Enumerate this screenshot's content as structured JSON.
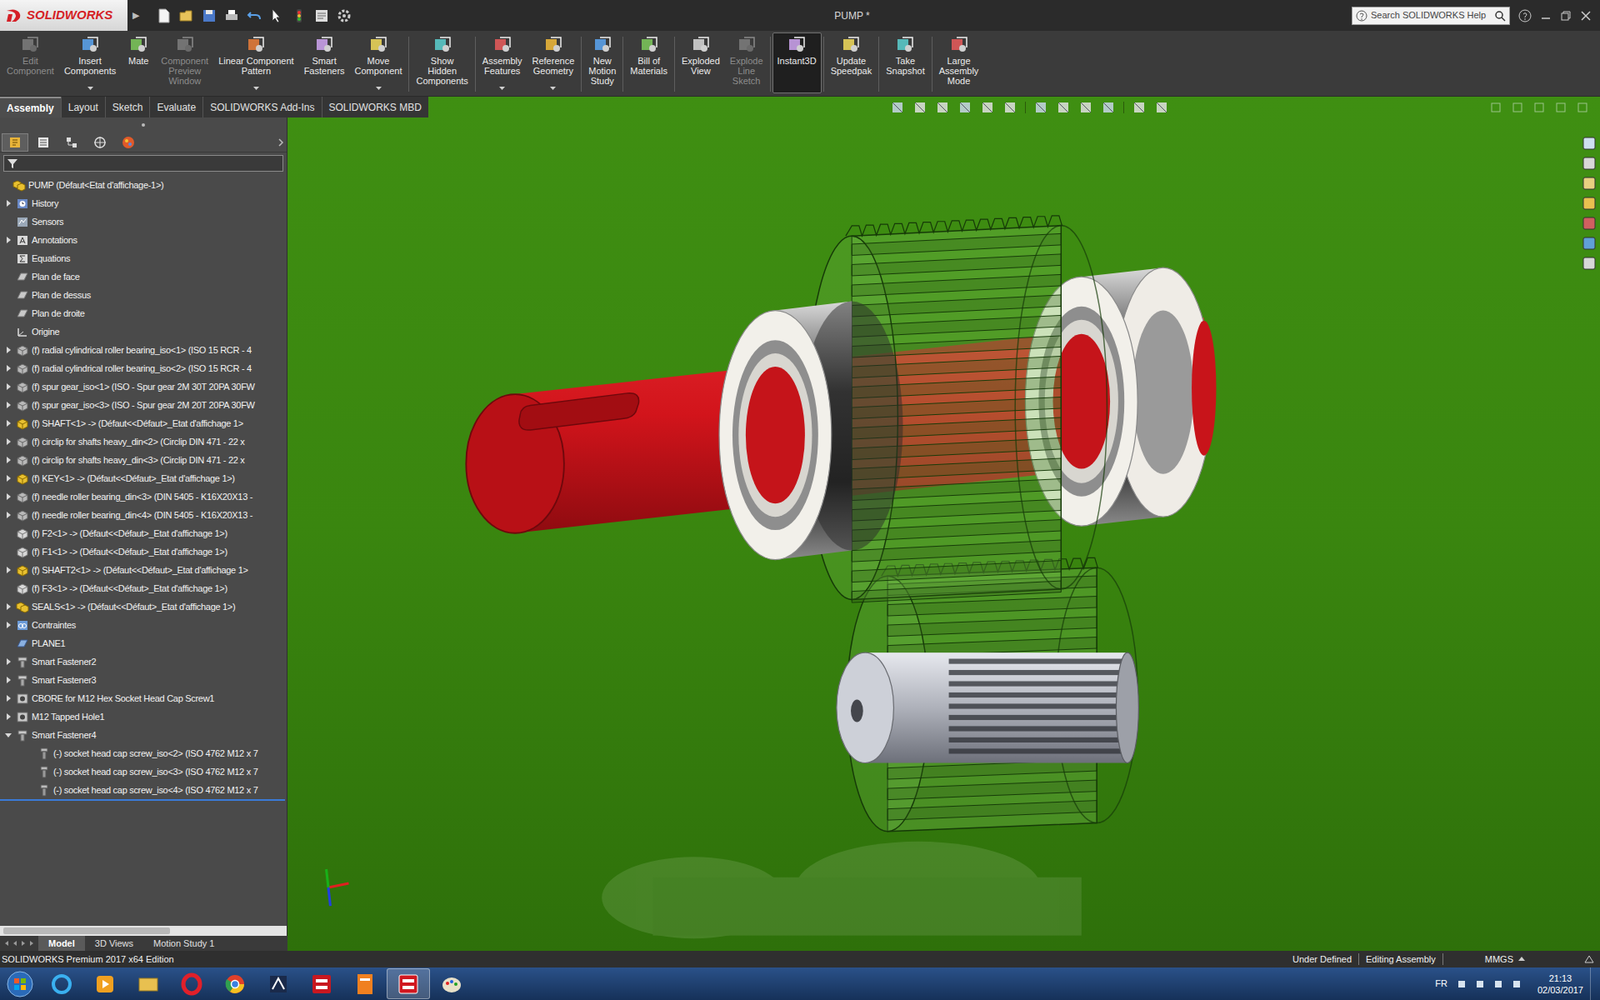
{
  "window": {
    "title": "PUMP *"
  },
  "app": {
    "logo": "SOLIDWORKS",
    "menu_arrow": "▶"
  },
  "search": {
    "placeholder": "Search SOLIDWORKS Help"
  },
  "ribbon": {
    "groups": [
      [
        {
          "lines": [
            "Edit",
            "Component"
          ],
          "disabled": true,
          "dropdown": false,
          "selected": false
        },
        {
          "lines": [
            "Insert",
            "Components"
          ],
          "disabled": false,
          "dropdown": true,
          "selected": false
        },
        {
          "lines": [
            "Mate"
          ],
          "disabled": false,
          "dropdown": false,
          "selected": false
        },
        {
          "lines": [
            "Component",
            "Preview",
            "Window"
          ],
          "disabled": true,
          "dropdown": false,
          "selected": false
        },
        {
          "lines": [
            "Linear Component",
            "Pattern"
          ],
          "disabled": false,
          "dropdown": true,
          "selected": false
        },
        {
          "lines": [
            "Smart",
            "Fasteners"
          ],
          "disabled": false,
          "dropdown": false,
          "selected": false
        },
        {
          "lines": [
            "Move",
            "Component"
          ],
          "disabled": false,
          "dropdown": true,
          "selected": false
        }
      ],
      [
        {
          "lines": [
            "Show",
            "Hidden",
            "Components"
          ],
          "disabled": false,
          "dropdown": false,
          "selected": false
        }
      ],
      [
        {
          "lines": [
            "Assembly",
            "Features"
          ],
          "disabled": false,
          "dropdown": true,
          "selected": false
        },
        {
          "lines": [
            "Reference",
            "Geometry"
          ],
          "disabled": false,
          "dropdown": true,
          "selected": false
        }
      ],
      [
        {
          "lines": [
            "New",
            "Motion",
            "Study"
          ],
          "disabled": false,
          "dropdown": false,
          "selected": false
        }
      ],
      [
        {
          "lines": [
            "Bill of",
            "Materials"
          ],
          "disabled": false,
          "dropdown": false,
          "selected": false
        }
      ],
      [
        {
          "lines": [
            "Exploded",
            "View"
          ],
          "disabled": false,
          "dropdown": false,
          "selected": false
        },
        {
          "lines": [
            "Explode",
            "Line",
            "Sketch"
          ],
          "disabled": true,
          "dropdown": false,
          "selected": false
        }
      ],
      [
        {
          "lines": [
            "Instant3D"
          ],
          "disabled": false,
          "dropdown": false,
          "selected": true
        }
      ],
      [
        {
          "lines": [
            "Update",
            "Speedpak"
          ],
          "disabled": false,
          "dropdown": false,
          "selected": false
        }
      ],
      [
        {
          "lines": [
            "Take",
            "Snapshot"
          ],
          "disabled": false,
          "dropdown": false,
          "selected": false
        }
      ],
      [
        {
          "lines": [
            "Large",
            "Assembly",
            "Mode"
          ],
          "disabled": false,
          "dropdown": false,
          "selected": false
        }
      ]
    ]
  },
  "tabs": [
    {
      "label": "Assembly",
      "selected": true
    },
    {
      "label": "Layout",
      "selected": false
    },
    {
      "label": "Sketch",
      "selected": false
    },
    {
      "label": "Evaluate",
      "selected": false
    },
    {
      "label": "SOLIDWORKS Add-Ins",
      "selected": false
    },
    {
      "label": "SOLIDWORKS MBD",
      "selected": false
    }
  ],
  "panel_tabs": [
    {
      "selected": true
    },
    {
      "selected": false
    },
    {
      "selected": false
    },
    {
      "selected": false
    },
    {
      "selected": false
    }
  ],
  "tree": {
    "root": {
      "label": "PUMP  (Défaut<Etat d'affichage-1>)",
      "kind": "assembly"
    },
    "items": [
      {
        "label": "History",
        "kind": "history",
        "expandable": true,
        "expanded": false
      },
      {
        "label": "Sensors",
        "kind": "sensor",
        "expandable": false,
        "expanded": false
      },
      {
        "label": "Annotations",
        "kind": "annotation",
        "expandable": true,
        "expanded": false
      },
      {
        "label": "Equations",
        "kind": "equation",
        "expandable": false,
        "expanded": false
      },
      {
        "label": "Plan de face",
        "kind": "plane",
        "expandable": false,
        "expanded": false
      },
      {
        "label": "Plan de dessus",
        "kind": "plane",
        "expandable": false,
        "expanded": false
      },
      {
        "label": "Plan de droite",
        "kind": "plane",
        "expandable": false,
        "expanded": false
      },
      {
        "label": "Origine",
        "kind": "origin",
        "expandable": false,
        "expanded": false
      },
      {
        "label": "(f) radial cylindrical roller bearing_iso<1> (ISO 15 RCR - 4",
        "kind": "toolbox",
        "expandable": true,
        "expanded": false
      },
      {
        "label": "(f) radial cylindrical roller bearing_iso<2> (ISO 15 RCR - 4",
        "kind": "toolbox",
        "expandable": true,
        "expanded": false
      },
      {
        "label": "(f) spur gear_iso<1> (ISO - Spur gear 2M 30T 20PA 30FW",
        "kind": "toolbox",
        "expandable": true,
        "expanded": false
      },
      {
        "label": "(f) spur gear_iso<3> (ISO - Spur gear 2M 20T 20PA 30FW",
        "kind": "toolbox",
        "expandable": true,
        "expanded": false
      },
      {
        "label": "(f) SHAFT<1> -> (Défaut<<Défaut>_Etat d'affichage 1>",
        "kind": "part",
        "expandable": true,
        "expanded": false
      },
      {
        "label": "(f) circlip for shafts heavy_din<2> (Circlip DIN 471 - 22 x",
        "kind": "toolbox",
        "expandable": true,
        "expanded": false
      },
      {
        "label": "(f) circlip for shafts heavy_din<3> (Circlip DIN 471 - 22 x",
        "kind": "toolbox",
        "expandable": true,
        "expanded": false
      },
      {
        "label": "(f) KEY<1> -> (Défaut<<Défaut>_Etat d'affichage 1>)",
        "kind": "part",
        "expandable": true,
        "expanded": false
      },
      {
        "label": "(f) needle roller bearing_din<3> (DIN 5405 - K16X20X13 -",
        "kind": "toolbox",
        "expandable": true,
        "expanded": false
      },
      {
        "label": "(f) needle roller bearing_din<4> (DIN 5405 - K16X20X13 -",
        "kind": "toolbox",
        "expandable": true,
        "expanded": false
      },
      {
        "label": "(f) F2<1> -> (Défaut<<Défaut>_Etat d'affichage 1>)",
        "kind": "subpart",
        "expandable": false,
        "expanded": false
      },
      {
        "label": "(f) F1<1> -> (Défaut<<Défaut>_Etat d'affichage 1>)",
        "kind": "subpart",
        "expandable": false,
        "expanded": false
      },
      {
        "label": "(f) SHAFT2<1> -> (Défaut<<Défaut>_Etat d'affichage 1>",
        "kind": "part",
        "expandable": true,
        "expanded": false
      },
      {
        "label": "(f) F3<1> -> (Défaut<<Défaut>_Etat d'affichage 1>)",
        "kind": "subpart",
        "expandable": false,
        "expanded": false
      },
      {
        "label": "SEALS<1> -> (Défaut<<Défaut>_Etat d'affichage 1>)",
        "kind": "assembly",
        "expandable": true,
        "expanded": false
      },
      {
        "label": "Contraintes",
        "kind": "mates",
        "expandable": true,
        "expanded": false
      },
      {
        "label": "PLANE1",
        "kind": "refplane",
        "expandable": false,
        "expanded": false
      },
      {
        "label": "Smart Fastener2",
        "kind": "fastener",
        "expandable": true,
        "expanded": false
      },
      {
        "label": "Smart Fastener3",
        "kind": "fastener",
        "expandable": true,
        "expanded": false
      },
      {
        "label": "CBORE for M12 Hex Socket Head Cap Screw1",
        "kind": "hole",
        "expandable": true,
        "expanded": false
      },
      {
        "label": "M12 Tapped Hole1",
        "kind": "hole",
        "expandable": true,
        "expanded": false
      },
      {
        "label": "Smart Fastener4",
        "kind": "fastener",
        "expandable": true,
        "expanded": true,
        "children": [
          {
            "label": "(-) socket head cap screw_iso<2> (ISO 4762 M12 x 7",
            "kind": "screw"
          },
          {
            "label": "(-) socket head cap screw_iso<3> (ISO 4762 M12 x 7",
            "kind": "screw"
          },
          {
            "label": "(-) socket head cap screw_iso<4> (ISO 4762 M12 x 7",
            "kind": "screw"
          }
        ]
      }
    ]
  },
  "bottom_tabs": [
    {
      "label": "Model",
      "selected": true
    },
    {
      "label": "3D Views",
      "selected": false
    },
    {
      "label": "Motion Study 1",
      "selected": false
    }
  ],
  "status_bar": {
    "edition": "SOLIDWORKS Premium 2017 x64 Edition",
    "state": "Under Defined",
    "mode": "Editing Assembly",
    "units": "MMGS"
  },
  "taskbar": {
    "language": "FR",
    "time": "21:13",
    "date": "02/03/2017"
  }
}
